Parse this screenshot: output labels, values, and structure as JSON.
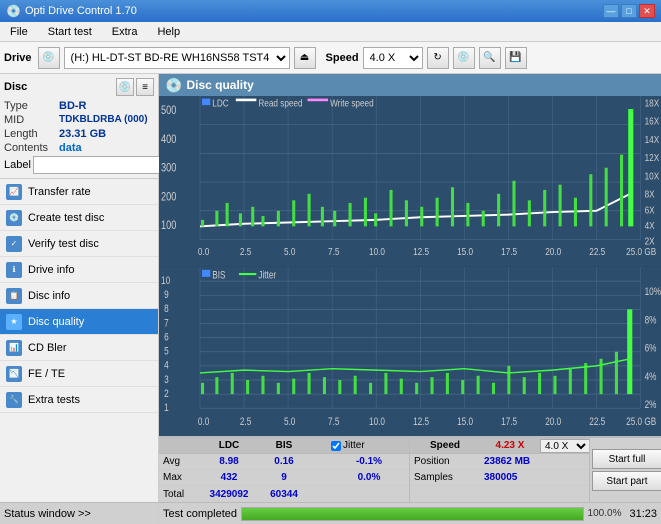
{
  "titlebar": {
    "title": "Opti Drive Control 1.70",
    "icon": "💿",
    "controls": [
      "—",
      "□",
      "✕"
    ]
  },
  "menubar": {
    "items": [
      "File",
      "Start test",
      "Extra",
      "Help"
    ]
  },
  "toolbar": {
    "drive_label": "Drive",
    "drive_value": "(H:) HL-DT-ST BD-RE  WH16NS58 TST4",
    "speed_label": "Speed",
    "speed_value": "4.0 X",
    "eject_icon": "⏏",
    "refresh_icon": "↻",
    "disc_icon": "💿",
    "save_icon": "💾"
  },
  "disc_panel": {
    "title": "Disc",
    "icons": [
      "≡",
      "✕"
    ],
    "fields": [
      {
        "label": "Type",
        "value": "BD-R"
      },
      {
        "label": "MID",
        "value": "TDKBLDRBA (000)"
      },
      {
        "label": "Length",
        "value": "23.31 GB"
      },
      {
        "label": "Contents",
        "value": "data"
      },
      {
        "label": "Label",
        "value": ""
      }
    ],
    "label_placeholder": ""
  },
  "nav": {
    "items": [
      {
        "id": "transfer-rate",
        "label": "Transfer rate",
        "icon": "📈",
        "active": false
      },
      {
        "id": "create-test-disc",
        "label": "Create test disc",
        "icon": "💿",
        "active": false
      },
      {
        "id": "verify-test-disc",
        "label": "Verify test disc",
        "icon": "✓",
        "active": false
      },
      {
        "id": "drive-info",
        "label": "Drive info",
        "icon": "ℹ",
        "active": false
      },
      {
        "id": "disc-info",
        "label": "Disc info",
        "icon": "📋",
        "active": false
      },
      {
        "id": "disc-quality",
        "label": "Disc quality",
        "icon": "★",
        "active": true
      },
      {
        "id": "cd-bler",
        "label": "CD Bler",
        "icon": "📊",
        "active": false
      },
      {
        "id": "fe-te",
        "label": "FE / TE",
        "icon": "📉",
        "active": false
      },
      {
        "id": "extra-tests",
        "label": "Extra tests",
        "icon": "🔧",
        "active": false
      }
    ]
  },
  "sidebar_status": {
    "label": "Status window >>",
    "arrows": ">>"
  },
  "chart": {
    "title": "Disc quality",
    "icon": "💿",
    "top_legend": [
      "LDC",
      "Read speed",
      "Write speed"
    ],
    "bottom_legend": [
      "BIS",
      "Jitter"
    ],
    "x_labels": [
      "0.0",
      "2.5",
      "5.0",
      "7.5",
      "10.0",
      "12.5",
      "15.0",
      "17.5",
      "20.0",
      "22.5",
      "25.0 GB"
    ],
    "top_y_left": [
      "500",
      "400",
      "300",
      "200",
      "100"
    ],
    "top_y_right": [
      "18X",
      "16X",
      "14X",
      "12X",
      "10X",
      "8X",
      "6X",
      "4X",
      "2X"
    ],
    "bottom_y_left": [
      "10",
      "9",
      "8",
      "7",
      "6",
      "5",
      "4",
      "3",
      "2",
      "1"
    ],
    "bottom_y_right": [
      "10%",
      "8%",
      "6%",
      "4%",
      "2%"
    ]
  },
  "stats": {
    "columns": [
      "",
      "LDC",
      "BIS",
      "",
      "Jitter",
      "Speed",
      ""
    ],
    "rows": [
      {
        "label": "Avg",
        "ldc": "8.98",
        "bis": "0.16",
        "sep": "",
        "jitter": "-0.1%",
        "speed_label": "Position",
        "speed_val": "23862 MB"
      },
      {
        "label": "Max",
        "ldc": "432",
        "bis": "9",
        "sep": "",
        "jitter": "0.0%",
        "speed_label": "Samples",
        "speed_val": "380005"
      },
      {
        "label": "Total",
        "ldc": "3429092",
        "bis": "60344",
        "sep": "",
        "jitter": "",
        "speed_label": "",
        "speed_val": ""
      }
    ],
    "jitter_checked": true,
    "jitter_label": "Jitter",
    "speed_current": "4.23 X",
    "speed_setting": "4.0 X",
    "btn_start_full": "Start full",
    "btn_start_part": "Start part"
  },
  "bottom_bar": {
    "status": "Test completed",
    "progress": 100.0,
    "progress_text": "100.0%",
    "time": "31:23"
  }
}
